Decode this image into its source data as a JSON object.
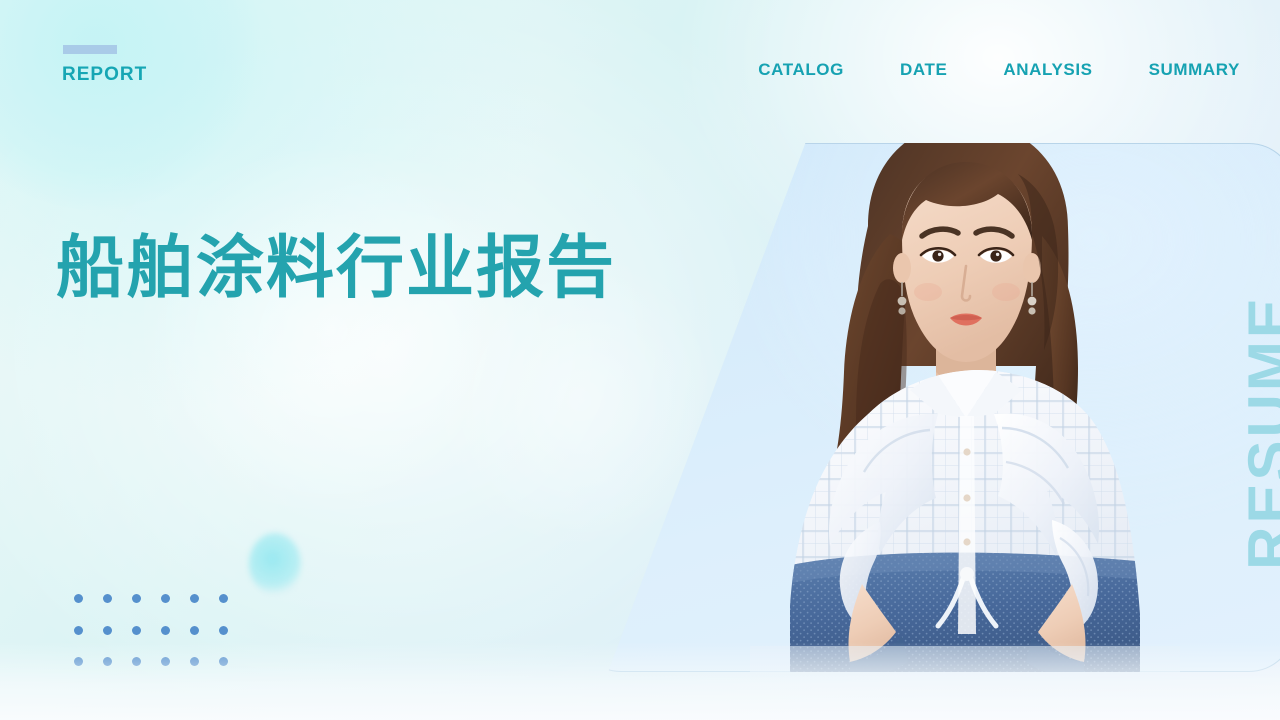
{
  "slide": {
    "kicker": "REPORT",
    "title": "船舶涂料行业报告",
    "side_label": "RESUME",
    "accent_color": "#16a6b4",
    "title_color": "#24a3ae",
    "bar_color": "#a9cbe8",
    "dot_color": "#5590cd",
    "side_label_color": "#9cd9e6",
    "panel_color": "#d9eefc",
    "background_colors": [
      "#e9f8f6",
      "#d9f3f4",
      "#eef4fb"
    ]
  },
  "nav": {
    "items": [
      {
        "label": "CATALOG"
      },
      {
        "label": "DATE"
      },
      {
        "label": "ANALYSIS"
      },
      {
        "label": "SUMMARY"
      }
    ]
  },
  "decor": {
    "dot_grid": {
      "columns": 6,
      "rows": 3
    },
    "icons": {
      "kicker_bar": "rectangle-bar-icon",
      "dots": "dot-grid-icon",
      "portrait": "woman-portrait-photo"
    }
  }
}
